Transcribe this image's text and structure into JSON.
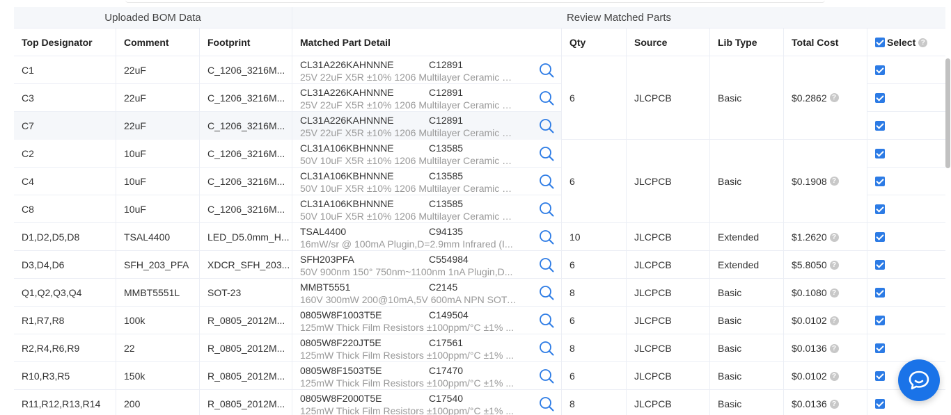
{
  "group_headers": {
    "left": "Uploaded BOM Data",
    "right": "Review Matched Parts"
  },
  "columns": {
    "designator": "Top Designator",
    "comment": "Comment",
    "footprint": "Footprint",
    "detail": "Matched Part Detail",
    "qty": "Qty",
    "source": "Source",
    "libtype": "Lib Type",
    "cost": "Total Cost",
    "select": "Select"
  },
  "rows": [
    {
      "designator": "C1",
      "comment": "22uF",
      "footprint": "C_1206_3216M...",
      "part": "CL31A226KAHNNNE",
      "code": "C12891",
      "desc": "25V 22uF X5R ±10% 1206 Multilayer Ceramic Ca...",
      "selected": true
    },
    {
      "designator": "C3",
      "comment": "22uF",
      "footprint": "C_1206_3216M...",
      "part": "CL31A226KAHNNNE",
      "code": "C12891",
      "desc": "25V 22uF X5R ±10% 1206 Multilayer Ceramic Ca...",
      "selected": true
    },
    {
      "designator": "C7",
      "comment": "22uF",
      "footprint": "C_1206_3216M...",
      "part": "CL31A226KAHNNNE",
      "code": "C12891",
      "desc": "25V 22uF X5R ±10% 1206 Multilayer Ceramic Ca...",
      "selected": true
    },
    {
      "designator": "C2",
      "comment": "10uF",
      "footprint": "C_1206_3216M...",
      "part": "CL31A106KBHNNNE",
      "code": "C13585",
      "desc": "50V 10uF X5R ±10% 1206 Multilayer Ceramic Ca...",
      "selected": true
    },
    {
      "designator": "C4",
      "comment": "10uF",
      "footprint": "C_1206_3216M...",
      "part": "CL31A106KBHNNNE",
      "code": "C13585",
      "desc": "50V 10uF X5R ±10% 1206 Multilayer Ceramic Ca...",
      "selected": true
    },
    {
      "designator": "C8",
      "comment": "10uF",
      "footprint": "C_1206_3216M...",
      "part": "CL31A106KBHNNNE",
      "code": "C13585",
      "desc": "50V 10uF X5R ±10% 1206 Multilayer Ceramic Ca...",
      "selected": true
    },
    {
      "designator": "D1,D2,D5,D8",
      "comment": "TSAL4400",
      "footprint": "LED_D5.0mm_H...",
      "part": "TSAL4400",
      "code": "C94135",
      "desc": "16mW/sr @ 100mA Plugin,D=2.9mm Infrared (I...",
      "qty": "10",
      "source": "JLCPCB",
      "libtype": "Extended",
      "cost": "$1.2620",
      "selected": true
    },
    {
      "designator": "D3,D4,D6",
      "comment": "SFH_203_PFA",
      "footprint": "XDCR_SFH_203...",
      "part": "SFH203PFA",
      "code": "C554984",
      "desc": "50V 900nm 150° 750nm~1100nm 1nA Plugin,D...",
      "qty": "6",
      "source": "JLCPCB",
      "libtype": "Extended",
      "cost": "$5.8050",
      "selected": true
    },
    {
      "designator": "Q1,Q2,Q3,Q4",
      "comment": "MMBT5551L",
      "footprint": "SOT-23",
      "part": "MMBT5551",
      "code": "C2145",
      "desc": "160V 300mW 200@10mA,5V 600mA NPN SOT-...",
      "qty": "8",
      "source": "JLCPCB",
      "libtype": "Basic",
      "cost": "$0.1080",
      "selected": true
    },
    {
      "designator": "R1,R7,R8",
      "comment": "100k",
      "footprint": "R_0805_2012M...",
      "part": "0805W8F1003T5E",
      "code": "C149504",
      "desc": "125mW Thick Film Resistors ±100ppm/°C ±1% ...",
      "qty": "6",
      "source": "JLCPCB",
      "libtype": "Basic",
      "cost": "$0.0102",
      "selected": true
    },
    {
      "designator": "R2,R4,R6,R9",
      "comment": "22",
      "footprint": "R_0805_2012M...",
      "part": "0805W8F220JT5E",
      "code": "C17561",
      "desc": "125mW Thick Film Resistors ±100ppm/°C ±1% ...",
      "qty": "8",
      "source": "JLCPCB",
      "libtype": "Basic",
      "cost": "$0.0136",
      "selected": true
    },
    {
      "designator": "R10,R3,R5",
      "comment": "150k",
      "footprint": "R_0805_2012M...",
      "part": "0805W8F1503T5E",
      "code": "C17470",
      "desc": "125mW Thick Film Resistors ±100ppm/°C ±1% ...",
      "qty": "6",
      "source": "JLCPCB",
      "libtype": "Basic",
      "cost": "$0.0102",
      "selected": true
    },
    {
      "designator": "R11,R12,R13,R14",
      "comment": "200",
      "footprint": "R_0805_2012M...",
      "part": "0805W8F2000T5E",
      "code": "C17540",
      "desc": "125mW Thick Film Resistors ±100ppm/°C ±1% ...",
      "qty": "8",
      "source": "JLCPCB",
      "libtype": "Basic",
      "cost": "$0.0136",
      "selected": true
    }
  ],
  "groups": [
    {
      "qty": "6",
      "source": "JLCPCB",
      "libtype": "Basic",
      "cost": "$0.2862"
    },
    {
      "qty": "6",
      "source": "JLCPCB",
      "libtype": "Basic",
      "cost": "$0.1908"
    }
  ],
  "icons": {
    "search": "search-icon",
    "help": "help-icon",
    "chat": "chat-icon",
    "check": "checkbox-checked-icon"
  },
  "colors": {
    "accent": "#1a73e8",
    "checkbox": "#2c7be5",
    "header_bg": "#f5f7fa",
    "muted_text": "#999999"
  }
}
